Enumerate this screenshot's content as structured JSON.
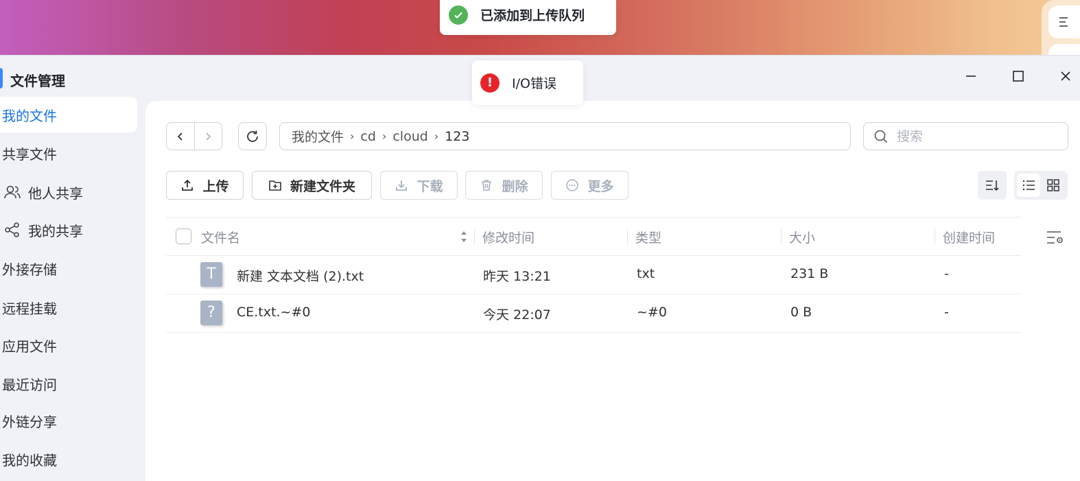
{
  "window": {
    "title": "文件管理"
  },
  "toasts": {
    "success": {
      "text": "已添加到上传队列",
      "color": "#52b35a"
    },
    "error": {
      "text": "I/O错误",
      "color": "#e5252a"
    }
  },
  "sidebar": {
    "items": [
      {
        "label": "我的文件",
        "active": true
      },
      {
        "label": "共享文件"
      },
      {
        "label": "他人共享",
        "icon": "users-icon"
      },
      {
        "label": "我的共享",
        "icon": "share-icon"
      },
      {
        "label": "外接存储"
      },
      {
        "label": "远程挂载"
      },
      {
        "label": "应用文件"
      },
      {
        "label": "最近访问"
      },
      {
        "label": "外链分享"
      },
      {
        "label": "我的收藏"
      }
    ]
  },
  "breadcrumb": {
    "parts": [
      "我的文件",
      "cd",
      "cloud",
      "123"
    ]
  },
  "search": {
    "placeholder": "搜索",
    "value": ""
  },
  "toolbar": {
    "upload": "上传",
    "new_folder": "新建文件夹",
    "download": "下载",
    "delete": "删除",
    "more": "更多"
  },
  "table": {
    "columns": [
      "文件名",
      "修改时间",
      "类型",
      "大小",
      "创建时间"
    ],
    "rows": [
      {
        "icon": "text-file-icon",
        "icon_glyph": "T",
        "name": "新建 文本文档 (2).txt",
        "modified": "昨天 13:21",
        "type": "txt",
        "size": "231 B",
        "created": "-"
      },
      {
        "icon": "unknown-file-icon",
        "icon_glyph": "?",
        "name": "CE.txt.~#0",
        "modified": "今天 22:07",
        "type": "~#0",
        "size": "0 B",
        "created": "-"
      }
    ]
  },
  "colors": {
    "accent": "#1a73e8"
  }
}
